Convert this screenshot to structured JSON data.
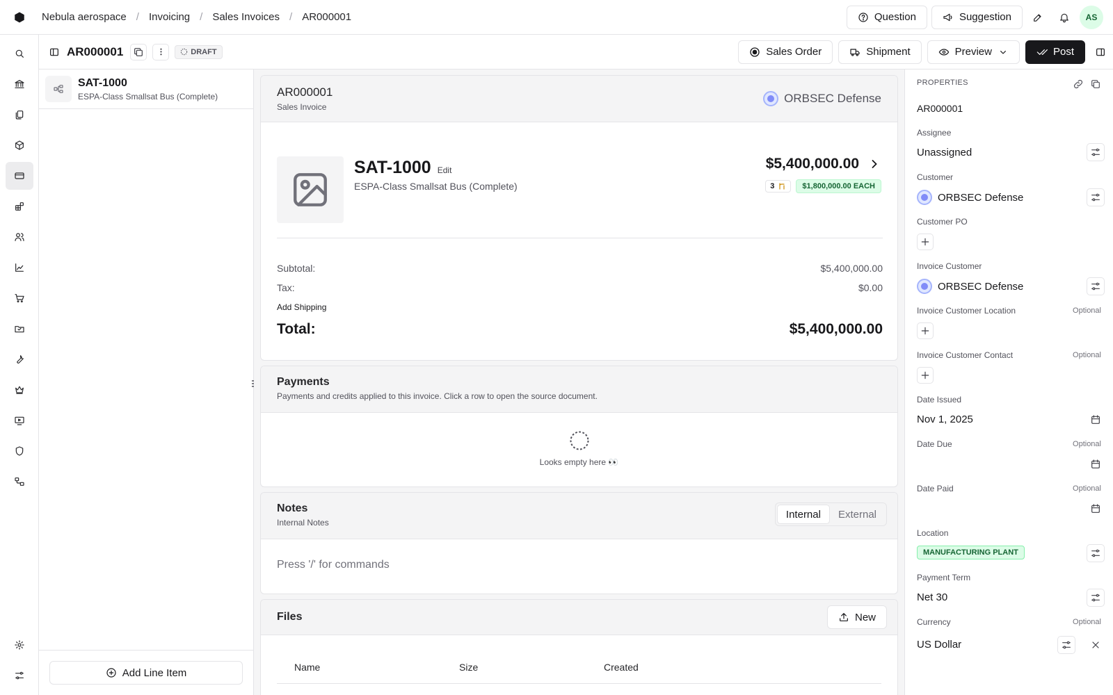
{
  "breadcrumb": [
    "Nebula aerospace",
    "Invoicing",
    "Sales Invoices",
    "AR000001"
  ],
  "top_actions": {
    "question": "Question",
    "suggestion": "Suggestion",
    "avatar_initials": "AS"
  },
  "doc_header": {
    "id": "AR000001",
    "status": "DRAFT",
    "actions": {
      "sales_order": "Sales Order",
      "shipment": "Shipment",
      "preview": "Preview",
      "post": "Post"
    }
  },
  "line_items": [
    {
      "code": "SAT-1000",
      "description": "ESPA-Class Smallsat Bus (Complete)"
    }
  ],
  "add_line_item": "Add Line Item",
  "invoice": {
    "id": "AR000001",
    "type": "Sales Invoice",
    "customer": "ORBSEC Defense",
    "item": {
      "code": "SAT-1000",
      "edit": "Edit",
      "description": "ESPA-Class Smallsat Bus (Complete)",
      "amount": "$5,400,000.00",
      "quantity": "3",
      "unit_price": "$1,800,000.00 EACH"
    },
    "summary": {
      "subtotal_label": "Subtotal:",
      "subtotal": "$5,400,000.00",
      "tax_label": "Tax:",
      "tax": "$0.00",
      "add_shipping": "Add Shipping",
      "total_label": "Total:",
      "total": "$5,400,000.00"
    }
  },
  "payments": {
    "title": "Payments",
    "subtitle": "Payments and credits applied to this invoice. Click a row to open the source document.",
    "empty": "Looks empty here 👀"
  },
  "notes": {
    "title": "Notes",
    "subtitle": "Internal Notes",
    "tabs": [
      "Internal",
      "External"
    ],
    "active_tab": "Internal",
    "placeholder": "Press '/' for commands"
  },
  "files": {
    "title": "Files",
    "new_label": "New",
    "columns": [
      "Name",
      "Size",
      "Created"
    ]
  },
  "properties": {
    "heading": "PROPERTIES",
    "id": "AR000001",
    "optional": "Optional",
    "assignee": {
      "label": "Assignee",
      "value": "Unassigned"
    },
    "customer": {
      "label": "Customer",
      "value": "ORBSEC Defense"
    },
    "customer_po": {
      "label": "Customer PO"
    },
    "invoice_customer": {
      "label": "Invoice Customer",
      "value": "ORBSEC Defense"
    },
    "invoice_customer_location": {
      "label": "Invoice Customer Location"
    },
    "invoice_customer_contact": {
      "label": "Invoice Customer Contact"
    },
    "date_issued": {
      "label": "Date Issued",
      "value": "Nov 1, 2025"
    },
    "date_due": {
      "label": "Date Due"
    },
    "date_paid": {
      "label": "Date Paid"
    },
    "location": {
      "label": "Location",
      "value": "MANUFACTURING PLANT"
    },
    "payment_term": {
      "label": "Payment Term",
      "value": "Net 30"
    },
    "currency": {
      "label": "Currency",
      "value": "US Dollar"
    }
  },
  "colors": {
    "primary_dark": "#18181b",
    "success_green": "#dcfce7",
    "accent_indigo": "#818cf8"
  },
  "icons": [
    "logo-icon",
    "search-icon",
    "bank-icon",
    "documents-icon",
    "box-icon",
    "credit-card-icon",
    "blocks-icon",
    "users-icon",
    "chart-icon",
    "cart-icon",
    "inbox-icon",
    "wrench-icon",
    "crown-icon",
    "presentation-icon",
    "shield-icon",
    "workflow-icon",
    "settings-icon",
    "sliders-icon"
  ]
}
